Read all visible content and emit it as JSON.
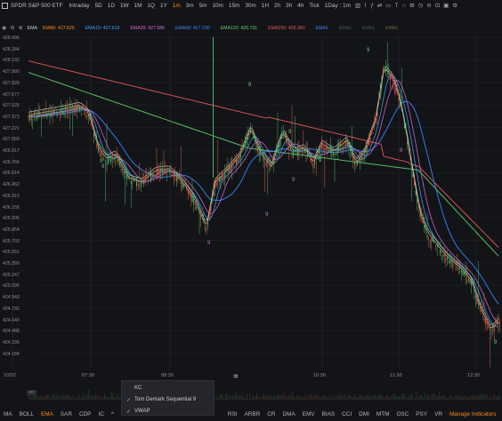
{
  "toolbar": {
    "symbol": "SPDR S&P 500 ETF",
    "intervals": [
      {
        "label": "Intraday",
        "active": false
      },
      {
        "label": "5D",
        "active": false
      },
      {
        "label": "1D",
        "active": false
      },
      {
        "label": "1W",
        "active": false
      },
      {
        "label": "1M",
        "active": false
      },
      {
        "label": "1Q",
        "active": false
      },
      {
        "label": "1Y",
        "active": false
      },
      {
        "label": "1m",
        "active": true
      },
      {
        "label": "3m",
        "active": false
      },
      {
        "label": "5m",
        "active": false
      },
      {
        "label": "10m",
        "active": false
      },
      {
        "label": "15m",
        "active": false
      },
      {
        "label": "30m",
        "active": false
      },
      {
        "label": "1H",
        "active": false
      },
      {
        "label": "2h",
        "active": false
      },
      {
        "label": "3h",
        "active": false
      },
      {
        "label": "4h",
        "active": false
      },
      {
        "label": "Tick",
        "active": false
      },
      {
        "label": "1Day : 1m",
        "active": false
      }
    ],
    "icons": [
      "candlestick-icon",
      "chart-style-icon",
      "indicator-icon",
      "compare-icon",
      "comment-icon",
      "text-icon",
      "draw-icon",
      "ruler-icon",
      "clock-icon",
      "cycle-icon",
      "layout-icon",
      "camera-icon",
      "settings-icon"
    ]
  },
  "legend": {
    "title": "EMA",
    "items": [
      {
        "label": "EMA5: 427.629",
        "color": "#ff8a1f"
      },
      {
        "label": "EMA10: 427.619",
        "color": "#3aa0ff"
      },
      {
        "label": "EMA20: 427.586",
        "color": "#d66bd6"
      },
      {
        "label": "EMA60: 427.230",
        "color": "#3a84ff"
      },
      {
        "label": "EMA120: 426.731",
        "color": "#5fcf6b"
      },
      {
        "label": "EMA250: 426.360",
        "color": "#e85a5a"
      },
      {
        "label": "EMA1",
        "color": "#3a84ff"
      },
      {
        "label": "EMA1",
        "color": "#4f5566"
      },
      {
        "label": "EMA1",
        "color": "#4f5566"
      },
      {
        "label": "EMA1",
        "color": "#7a6a3a"
      }
    ]
  },
  "y_axis": [
    "428.436",
    "428.284",
    "428.132",
    "427.980",
    "427.829",
    "427.677",
    "427.525",
    "427.373",
    "427.221",
    "427.069",
    "426.917",
    "426.766",
    "426.614",
    "426.462",
    "426.310",
    "426.158",
    "426.006",
    "425.854",
    "425.703",
    "425.551",
    "425.399",
    "425.247",
    "425.095",
    "424.943",
    "424.792",
    "424.640",
    "424.488",
    "424.336",
    "424.184"
  ],
  "x_axis": [
    "10/02",
    "07:30",
    "08:30",
    "10:30",
    "11:30",
    "12:30"
  ],
  "bottom": {
    "items": [
      {
        "label": "MA",
        "active": false
      },
      {
        "label": "BOLL",
        "active": false
      },
      {
        "label": "EMA",
        "active": true
      },
      {
        "label": "SAR",
        "active": false
      },
      {
        "label": "CDP",
        "active": false
      },
      {
        "label": "IC",
        "active": false
      },
      {
        "label": "RSI",
        "active": false
      },
      {
        "label": "ARBR",
        "active": false
      },
      {
        "label": "CR",
        "active": false
      },
      {
        "label": "DMA",
        "active": false
      },
      {
        "label": "EMV",
        "active": false
      },
      {
        "label": "BIAS",
        "active": false
      },
      {
        "label": "CCI",
        "active": false
      },
      {
        "label": "DMI",
        "active": false
      },
      {
        "label": "MTM",
        "active": false
      },
      {
        "label": "OSC",
        "active": false
      },
      {
        "label": "PSY",
        "active": false
      },
      {
        "label": "VR",
        "active": false
      }
    ],
    "manage_label": "Manage Indicators",
    "collapse_label": "•••"
  },
  "popup": {
    "items": [
      {
        "label": "KC",
        "checked": false
      },
      {
        "label": "Tom Demark Sequential 9",
        "checked": true
      },
      {
        "label": "VWAP",
        "checked": true
      }
    ]
  },
  "colors": {
    "up": "#e25a4a",
    "down": "#4fb26a",
    "seq_green": "#5fcf6b",
    "seq_purple": "#c66bd6",
    "accent": "#ff8a1f"
  }
}
